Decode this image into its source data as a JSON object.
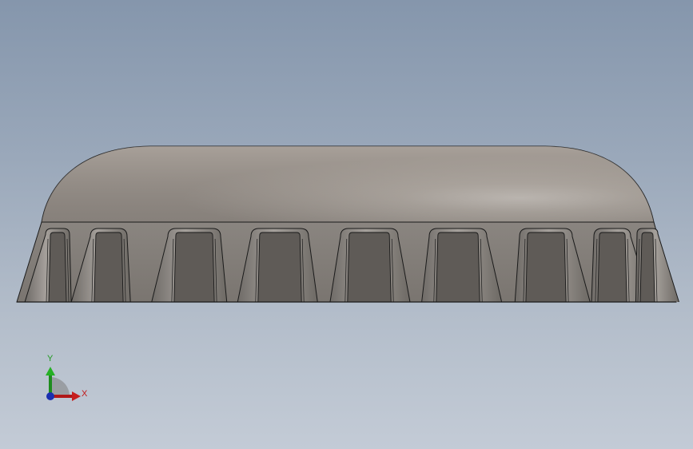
{
  "axes": {
    "x_label": "X",
    "y_label": "Y",
    "x_color": "#b01818",
    "y_color": "#1e8c1e",
    "z_color": "#1a2fb0"
  },
  "part": {
    "view": "front",
    "body_color": "#8e8a85",
    "dome_highlight": "#d9d4cf",
    "edge_color": "#1a1a1a",
    "rib_count": 9
  }
}
